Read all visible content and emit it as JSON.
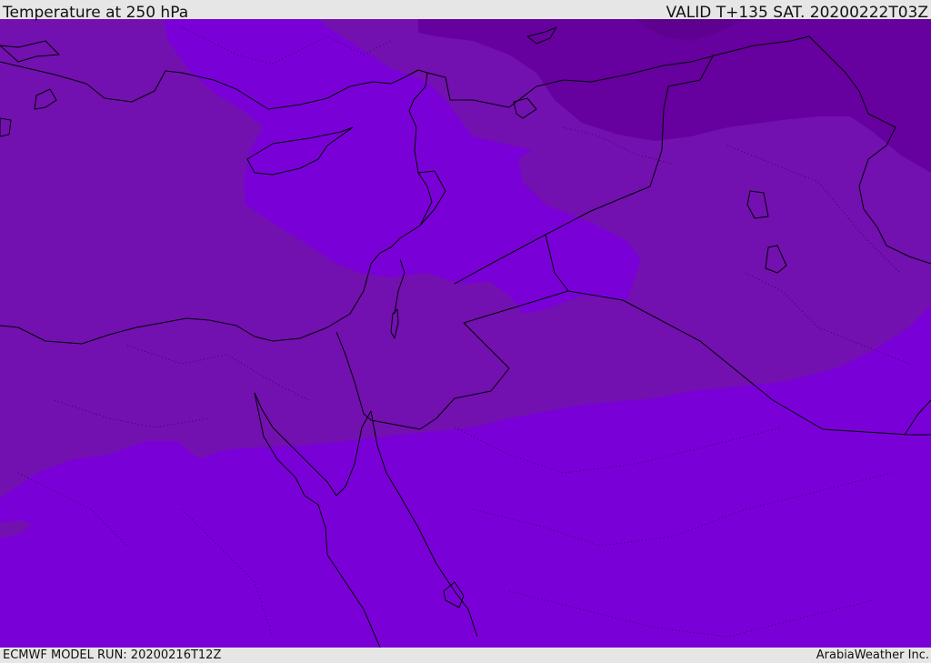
{
  "header": {
    "title": "Temperature at 250 hPa",
    "valid_time": "VALID T+135 SAT. 20200222T03Z"
  },
  "footer": {
    "model_run": "ECMWF MODEL RUN: 20200216T12Z",
    "credit": "ArabiaWeather Inc."
  },
  "map": {
    "field_colors": {
      "band_coldest": "#5e0090",
      "band_colder": "#66009e",
      "band_cold": "#7310b0",
      "band_base": "#7a00d8"
    }
  }
}
